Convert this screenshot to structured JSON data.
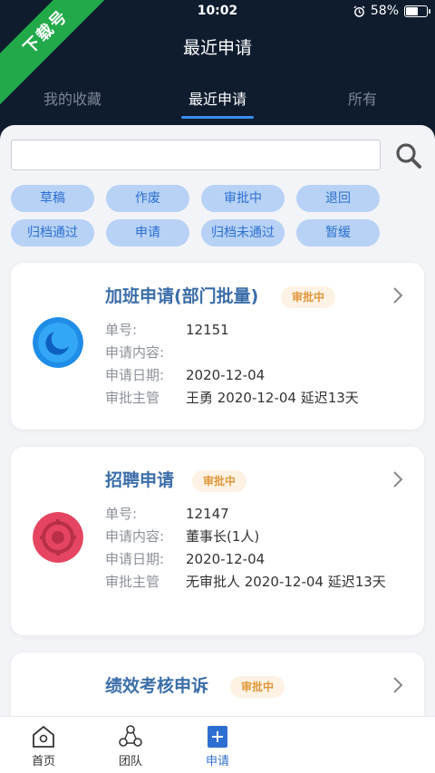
{
  "watermark": "下载号",
  "status": {
    "time": "10:02",
    "battery": "58%",
    "battery_level": 0.58
  },
  "header": {
    "title": "最近申请"
  },
  "tabs": [
    {
      "label": "我的收藏"
    },
    {
      "label": "最近申请"
    },
    {
      "label": "所有"
    }
  ],
  "search": {
    "placeholder": "",
    "value": ""
  },
  "filters": [
    "草稿",
    "作废",
    "审批中",
    "退回",
    "归档通过",
    "申请",
    "归档未通过",
    "暂缓"
  ],
  "cards": [
    {
      "title": "加班申请(部门批量)",
      "badge": "审批中",
      "fields": [
        {
          "label": "单号:",
          "value": "12151"
        },
        {
          "label": "申请内容:",
          "value": ""
        },
        {
          "label": "申请日期:",
          "value": "2020-12-04"
        },
        {
          "label": "审批主管",
          "value": "王勇 2020-12-04 延迟13天"
        }
      ]
    },
    {
      "title": "招聘申请",
      "badge": "审批中",
      "fields": [
        {
          "label": "单号:",
          "value": "12147"
        },
        {
          "label": "申请内容:",
          "value": "董事长(1人)"
        },
        {
          "label": "申请日期:",
          "value": "2020-12-04"
        },
        {
          "label": "审批主管",
          "value": "无审批人 2020-12-04 延迟13天"
        }
      ]
    },
    {
      "title": "绩效考核申诉",
      "badge": "审批中",
      "fields": []
    }
  ],
  "nav": [
    {
      "label": "首页"
    },
    {
      "label": "团队"
    },
    {
      "label": "申请"
    }
  ],
  "colors": {
    "accent": "#2c6fd0",
    "header_bg": "#0f1c2e",
    "badge_text": "#e0973a"
  }
}
